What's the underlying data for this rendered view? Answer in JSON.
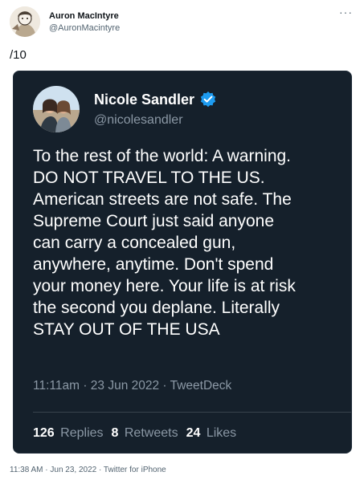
{
  "author": {
    "name": "Auron MacIntyre",
    "handle": "@AuronMacintyre"
  },
  "more_icon": "more-horizontal-icon",
  "tweet_text": "/10",
  "embedded": {
    "name": "Nicole Sandler",
    "handle": "@nicolesandler",
    "verified_icon": "verified-badge-icon",
    "verified_color": "#1d9bf0",
    "background": "#15202b",
    "lines": [
      "To the rest of the world: A warning.",
      "DO NOT TRAVEL TO THE US.",
      "American streets are not safe. The",
      "Supreme Court just said anyone",
      "can carry a concealed gun,",
      "anywhere, anytime. Don't spend",
      "your money here. Your life is at risk",
      "the second you deplane. Literally",
      "STAY OUT OF THE USA"
    ],
    "meta": "11:11am · 23 Jun 2022 · TweetDeck",
    "stats": {
      "replies_count": "126",
      "replies_label": "Replies",
      "retweets_count": "8",
      "retweets_label": "Retweets",
      "likes_count": "24",
      "likes_label": "Likes"
    }
  },
  "timestamp": "11:38 AM · Jun 23, 2022 · Twitter for iPhone"
}
